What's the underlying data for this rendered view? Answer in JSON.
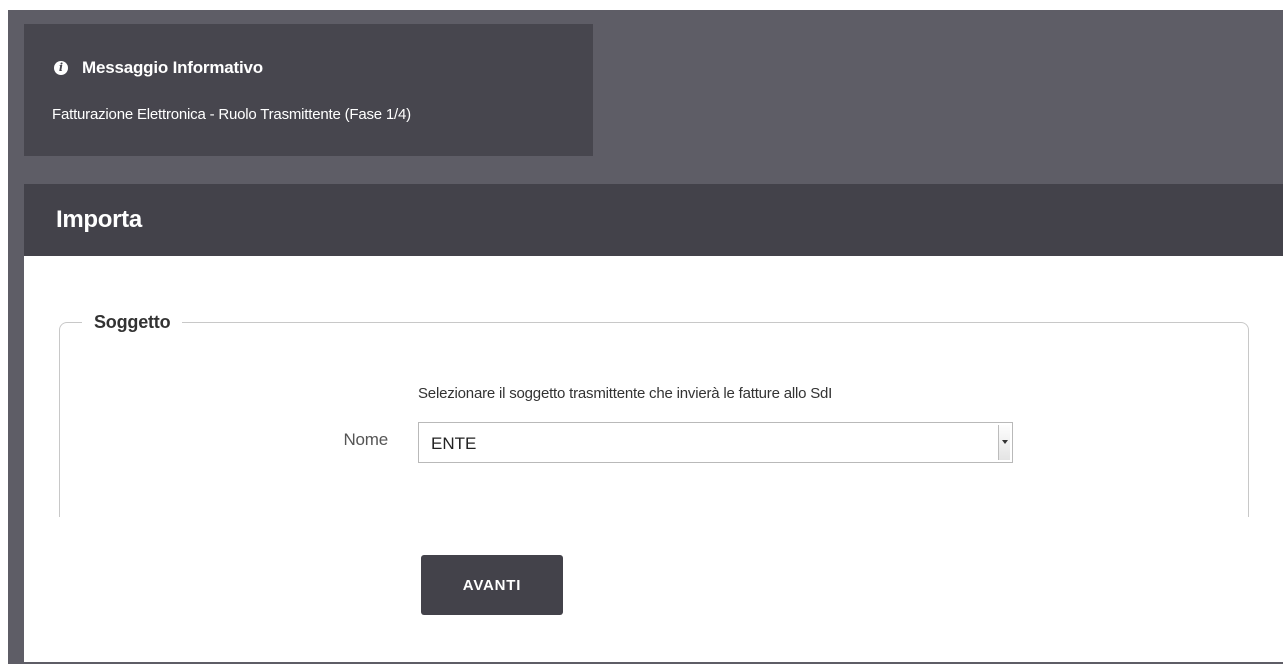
{
  "info": {
    "icon": "info-circle-icon",
    "title": "Messaggio Informativo",
    "message": "Fatturazione Elettronica - Ruolo Trasmittente (Fase 1/4)"
  },
  "panel": {
    "title": "Importa"
  },
  "form": {
    "fieldset_legend": "Soggetto",
    "hint": "Selezionare il soggetto trasmittente che invierà le fatture allo SdI",
    "nome_label": "Nome",
    "nome_value": "ENTE",
    "submit_label": "AVANTI"
  },
  "colors": {
    "frame_bg": "#5e5d66",
    "info_bg": "#47464e",
    "header_bg": "#43424a",
    "button_bg": "#43424a"
  }
}
